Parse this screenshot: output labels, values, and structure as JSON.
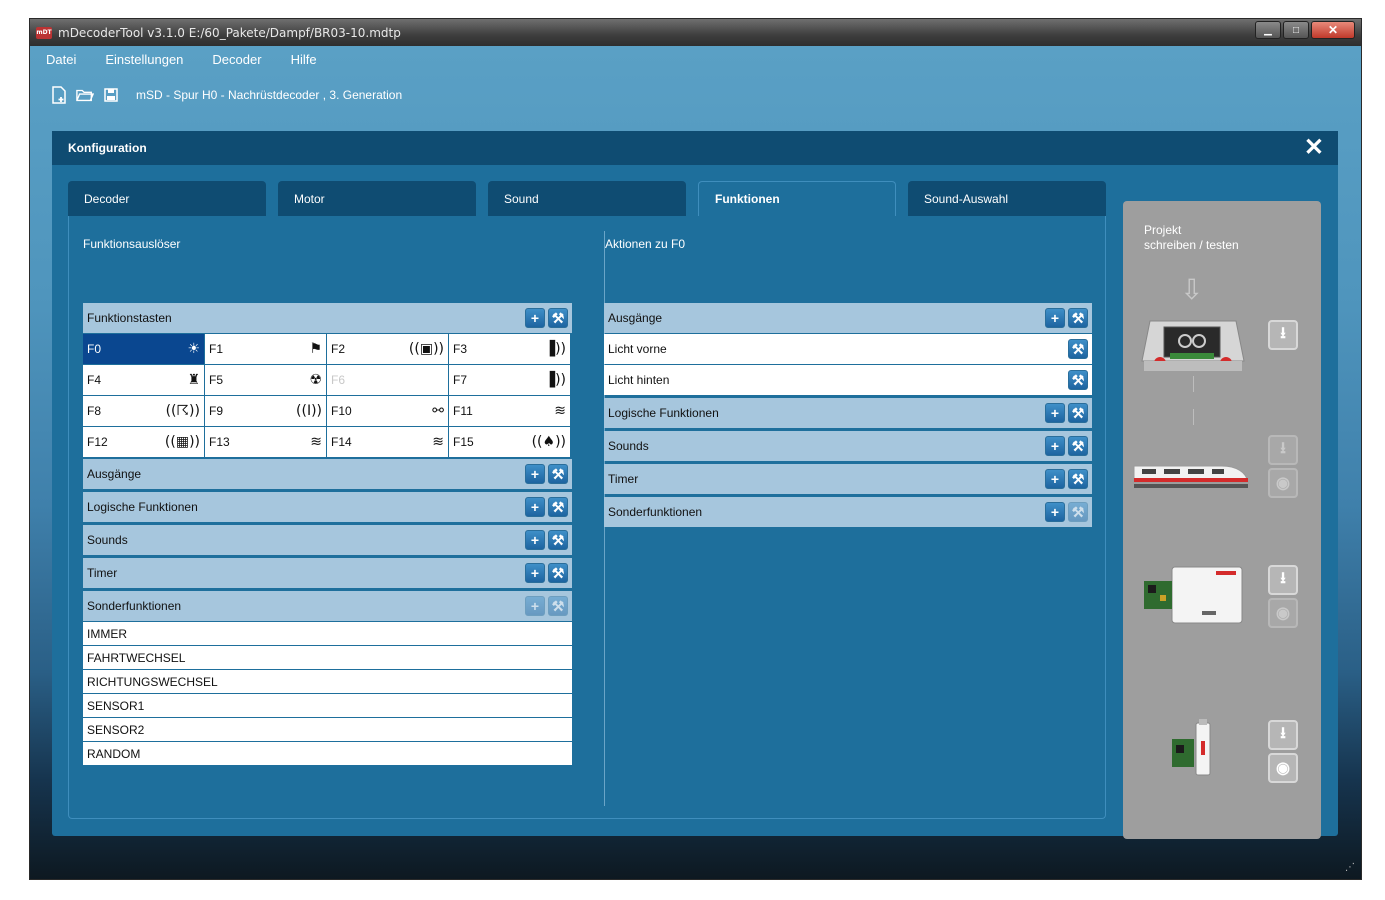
{
  "window": {
    "title": "mDecoderTool v3.1.0  E:/60_Pakete/Dampf/BR03-10.mdtp",
    "logo_text": "mDT"
  },
  "menu": [
    "Datei",
    "Einstellungen",
    "Decoder",
    "Hilfe"
  ],
  "toolbar": {
    "label": "mSD - Spur H0 - Nachrüstdecoder , 3. Generation",
    "icons": [
      "new-file-icon",
      "open-folder-icon",
      "save-icon"
    ]
  },
  "dialog": {
    "title": "Konfiguration"
  },
  "tabs": [
    {
      "label": "Decoder"
    },
    {
      "label": "Motor"
    },
    {
      "label": "Sound"
    },
    {
      "label": "Funktionen",
      "active": true
    },
    {
      "label": "Sound-Auswahl"
    }
  ],
  "left": {
    "section_label": "Funktionsauslöser",
    "keys_header": "Funktionstasten",
    "keys": [
      {
        "label": "F0",
        "icon": "☀",
        "selected": true
      },
      {
        "label": "F1",
        "icon": "⚑"
      },
      {
        "label": "F2",
        "icon": "((▣))"
      },
      {
        "label": "F3",
        "icon": "▐))"
      },
      {
        "label": "F4",
        "icon": "♜"
      },
      {
        "label": "F5",
        "icon": "☢"
      },
      {
        "label": "F6",
        "icon": "",
        "disabled": true
      },
      {
        "label": "F7",
        "icon": "▐))"
      },
      {
        "label": "F8",
        "icon": "((☈))"
      },
      {
        "label": "F9",
        "icon": "((I))"
      },
      {
        "label": "F10",
        "icon": "⚯"
      },
      {
        "label": "F11",
        "icon": "≋"
      },
      {
        "label": "F12",
        "icon": "((▦))"
      },
      {
        "label": "F13",
        "icon": "≋"
      },
      {
        "label": "F14",
        "icon": "≋"
      },
      {
        "label": "F15",
        "icon": "((♠))"
      }
    ],
    "groups": [
      "Ausgänge",
      "Logische Funktionen",
      "Sounds",
      "Timer",
      "Sonderfunktionen"
    ],
    "special_items": [
      "IMMER",
      "FAHRTWECHSEL",
      "RICHTUNGSWECHSEL",
      "SENSOR1",
      "SENSOR2",
      "RANDOM"
    ]
  },
  "right": {
    "section_label": "Aktionen zu F0",
    "outputs_header": "Ausgänge",
    "outputs": [
      "Licht vorne",
      "Licht hinten"
    ],
    "groups": [
      "Logische Funktionen",
      "Sounds",
      "Timer",
      "Sonderfunktionen"
    ]
  },
  "project": {
    "title_line1": "Projekt",
    "title_line2": "schreiben / testen"
  }
}
